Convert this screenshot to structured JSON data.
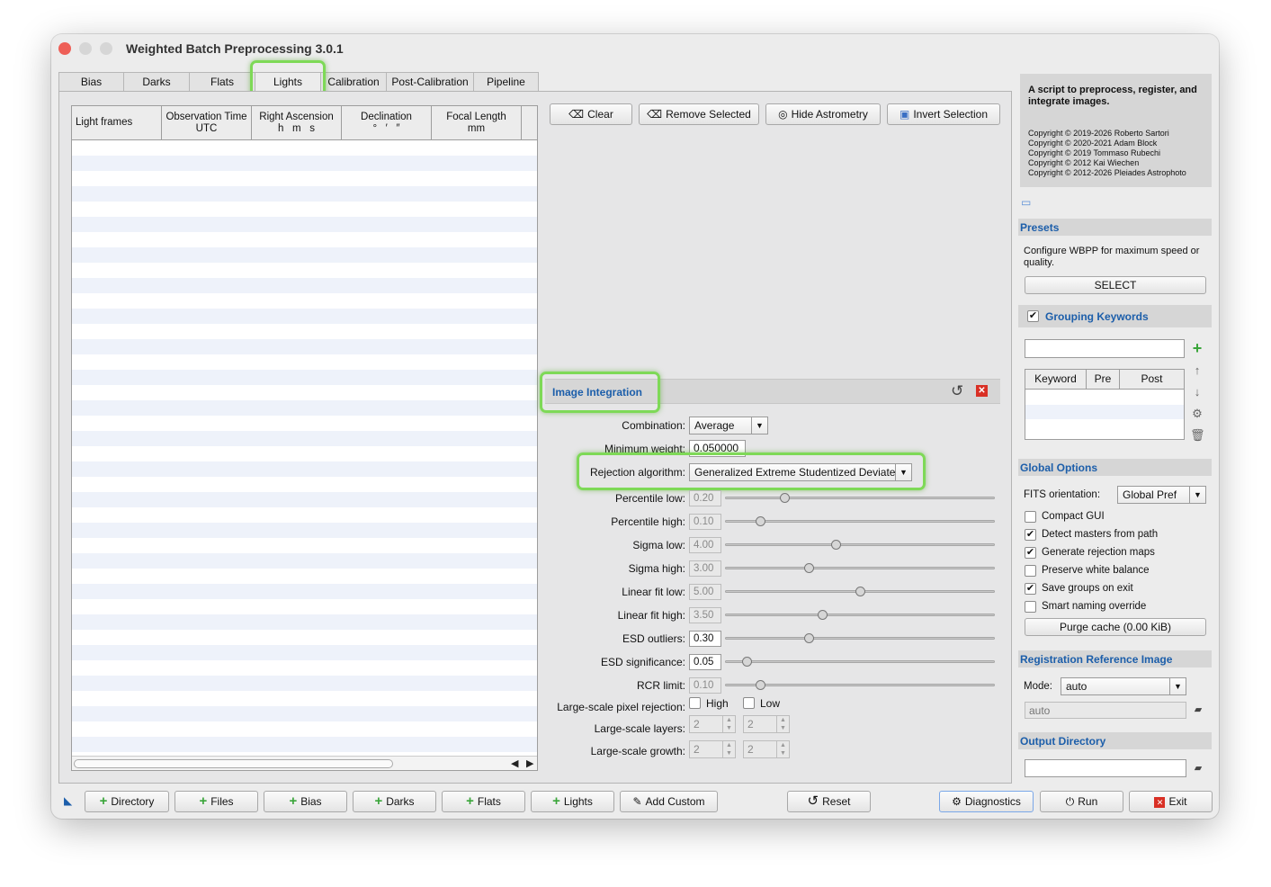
{
  "window": {
    "title": "Weighted Batch Preprocessing 3.0.1"
  },
  "tabs": [
    "Bias",
    "Darks",
    "Flats",
    "Lights",
    "Calibration",
    "Post-Calibration",
    "Pipeline"
  ],
  "table": {
    "headers": [
      [
        "Light frames",
        ""
      ],
      [
        "Observation Time",
        "UTC"
      ],
      [
        "Right Ascension",
        "h   m   s"
      ],
      [
        "Declination",
        "°   ′   ″"
      ],
      [
        "Focal Length",
        "mm"
      ]
    ]
  },
  "toolbar": {
    "clear": "Clear",
    "remove_selected": "Remove Selected",
    "hide_astrometry": "Hide Astrometry",
    "invert_selection": "Invert Selection"
  },
  "integration": {
    "title": "Image Integration",
    "combination": {
      "label": "Combination:",
      "value": "Average"
    },
    "min_weight": {
      "label": "Minimum weight:",
      "value": "0.050000"
    },
    "rejection": {
      "label": "Rejection algorithm:",
      "value": "Generalized Extreme Studentized Deviate"
    },
    "params": [
      {
        "label": "Percentile low:",
        "value": "0.20",
        "enabled": false,
        "level": 0.22
      },
      {
        "label": "Percentile high:",
        "value": "0.10",
        "enabled": false,
        "level": 0.13
      },
      {
        "label": "Sigma low:",
        "value": "4.00",
        "enabled": false,
        "level": 0.41
      },
      {
        "label": "Sigma high:",
        "value": "3.00",
        "enabled": false,
        "level": 0.31
      },
      {
        "label": "Linear fit low:",
        "value": "5.00",
        "enabled": false,
        "level": 0.5
      },
      {
        "label": "Linear fit high:",
        "value": "3.50",
        "enabled": false,
        "level": 0.36
      },
      {
        "label": "ESD outliers:",
        "value": "0.30",
        "enabled": true,
        "level": 0.31
      },
      {
        "label": "ESD significance:",
        "value": "0.05",
        "enabled": true,
        "level": 0.08
      },
      {
        "label": "RCR limit:",
        "value": "0.10",
        "enabled": false,
        "level": 0.13
      }
    ],
    "largescale_rejection": {
      "label": "Large-scale pixel rejection:",
      "high": "High",
      "low": "Low"
    },
    "largescale_layers": {
      "label": "Large-scale layers:",
      "high": "2",
      "low": "2"
    },
    "largescale_growth": {
      "label": "Large-scale growth:",
      "high": "2",
      "low": "2"
    }
  },
  "bottom": {
    "directory": "Directory",
    "files": "Files",
    "bias": "Bias",
    "darks": "Darks",
    "flats": "Flats",
    "lights": "Lights",
    "add_custom": "Add Custom",
    "reset": "Reset",
    "diagnostics": "Diagnostics",
    "run": "Run",
    "exit": "Exit"
  },
  "info": {
    "headline": "A script to preprocess, register, and integrate images.",
    "copyrights": [
      "Copyright © 2019-2026 Roberto Sartori",
      "Copyright © 2020-2021 Adam Block",
      "Copyright © 2019 Tommaso Rubechi",
      "Copyright © 2012 Kai Wiechen",
      "Copyright © 2012-2026 Pleiades Astrophoto"
    ]
  },
  "presets": {
    "title": "Presets",
    "text": "Configure WBPP for maximum speed or quality.",
    "button": "SELECT"
  },
  "grouping": {
    "title": "Grouping Keywords",
    "headers": [
      "Keyword",
      "Pre",
      "Post"
    ]
  },
  "global": {
    "title": "Global Options",
    "fits_label": "FITS orientation:",
    "fits_value": "Global Pref",
    "options": [
      {
        "label": "Compact GUI",
        "checked": false
      },
      {
        "label": "Detect masters from path",
        "checked": true
      },
      {
        "label": "Generate rejection maps",
        "checked": true
      },
      {
        "label": "Preserve white balance",
        "checked": false
      },
      {
        "label": "Save groups on exit",
        "checked": true
      },
      {
        "label": "Smart naming override",
        "checked": false
      }
    ],
    "purge": "Purge cache (0.00 KiB)"
  },
  "registration": {
    "title": "Registration Reference Image",
    "mode_label": "Mode:",
    "mode_value": "auto",
    "ref_placeholder": "auto"
  },
  "output": {
    "title": "Output Directory"
  }
}
